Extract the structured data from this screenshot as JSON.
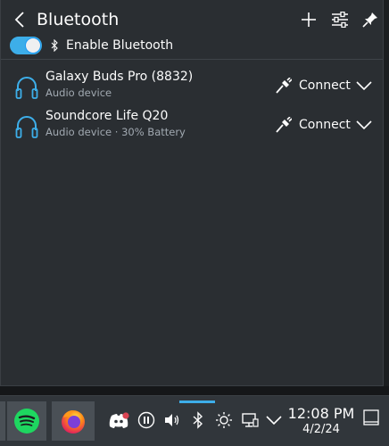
{
  "header": {
    "title": "Bluetooth",
    "back_icon": "back-arrow-icon",
    "add_icon": "plus-icon",
    "configure_icon": "sliders-icon",
    "pin_icon": "pin-icon"
  },
  "toggle": {
    "label": "Enable Bluetooth",
    "enabled": true
  },
  "devices": [
    {
      "name": "Galaxy Buds Pro (8832)",
      "subtitle": "Audio device",
      "icon": "headphones-icon",
      "action_label": "Connect",
      "action_icon": "plug-icon"
    },
    {
      "name": "Soundcore Life Q20",
      "subtitle": "Audio device · 30% Battery",
      "icon": "headphones-icon",
      "action_label": "Connect",
      "action_icon": "plug-icon"
    }
  ],
  "taskbar": {
    "apps": [
      "spotify-icon",
      "firefox-icon"
    ],
    "tray": [
      "discord-icon",
      "media-pause-icon",
      "volume-icon",
      "bluetooth-icon",
      "brightness-icon",
      "display-icon",
      "chevron-up-icon"
    ]
  },
  "clock": {
    "time": "12:08 PM",
    "date": "4/2/24"
  },
  "colors": {
    "accent": "#3daee9",
    "panel_bg": "#2a2e32",
    "taskbar_bg": "#31363b",
    "spotify": "#1ed760",
    "discord": "#ffffff"
  }
}
